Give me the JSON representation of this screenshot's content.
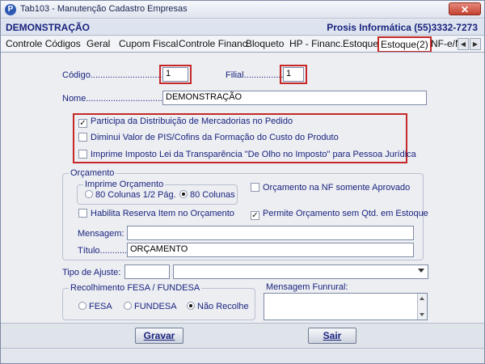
{
  "window": {
    "title": "Tab103 - Manutenção Cadastro Empresas",
    "close_label": "✕",
    "app_icon_letter": "P"
  },
  "header": {
    "company_name": "DEMONSTRAÇÃO",
    "vendor": "Prosis Informática (55)3332-7273"
  },
  "tabs": [
    {
      "label": "Controle Códigos"
    },
    {
      "label": "Geral"
    },
    {
      "label": "Cupom Fiscal"
    },
    {
      "label": "Controle Financ."
    },
    {
      "label": "Bloqueto"
    },
    {
      "label": "HP - Financ."
    },
    {
      "label": "Estoque"
    },
    {
      "label": "Estoque(2)",
      "active": true
    },
    {
      "label": "NF-e/N"
    }
  ],
  "tab_scroll": {
    "left": "◀",
    "right": "▶"
  },
  "form": {
    "codigo_label": "Código...................................:",
    "codigo_value": "1",
    "filial_label": "Filial.................:",
    "filial_value": "1",
    "nome_label": "Nome.......................................:",
    "nome_value": "DEMONSTRAÇÃO"
  },
  "options": [
    {
      "label": "Participa da Distribuição de Mercadorias no Pedido",
      "checked": true
    },
    {
      "label": "Diminui Valor de PIS/Cofins da Formação do Custo do Produto",
      "checked": false
    },
    {
      "label": "Imprime Imposto Lei da Transparência \"De Olho  no Imposto\" para Pessoa Jurídica",
      "checked": false
    }
  ],
  "orcamento": {
    "group_title": "Orçamento",
    "imprime_title": "Imprime Orçamento",
    "radio_80_half": "80 Colunas 1/2 Pág.",
    "radio_80_full": "80 Colunas",
    "selected": "80 Colunas",
    "nf_aprovado_label": "Orçamento na NF somente Aprovado",
    "nf_aprovado_checked": false,
    "reserva_label": "Habilita Reserva Item no Orçamento",
    "reserva_checked": false,
    "sem_estoque_label": "Permite Orçamento sem Qtd. em Estoque",
    "sem_estoque_checked": true,
    "mensagem_label": "Mensagem:",
    "mensagem_value": "",
    "titulo_label": "Título.............:",
    "titulo_value": "ORÇAMENTO"
  },
  "ajuste": {
    "label": "Tipo de Ajuste:",
    "code_value": "",
    "select_value": ""
  },
  "fesa": {
    "group_title": "Recolhimento FESA / FUNDESA",
    "opt_fesa": "FESA",
    "opt_fundesa": "FUNDESA",
    "opt_nao": "Não Recolhe",
    "selected": "Não Recolhe"
  },
  "funrural": {
    "label": "Mensagem Funrural:",
    "value": ""
  },
  "buttons": {
    "gravar": "Gravar",
    "sair": "Sair"
  },
  "check_mark": "✓"
}
